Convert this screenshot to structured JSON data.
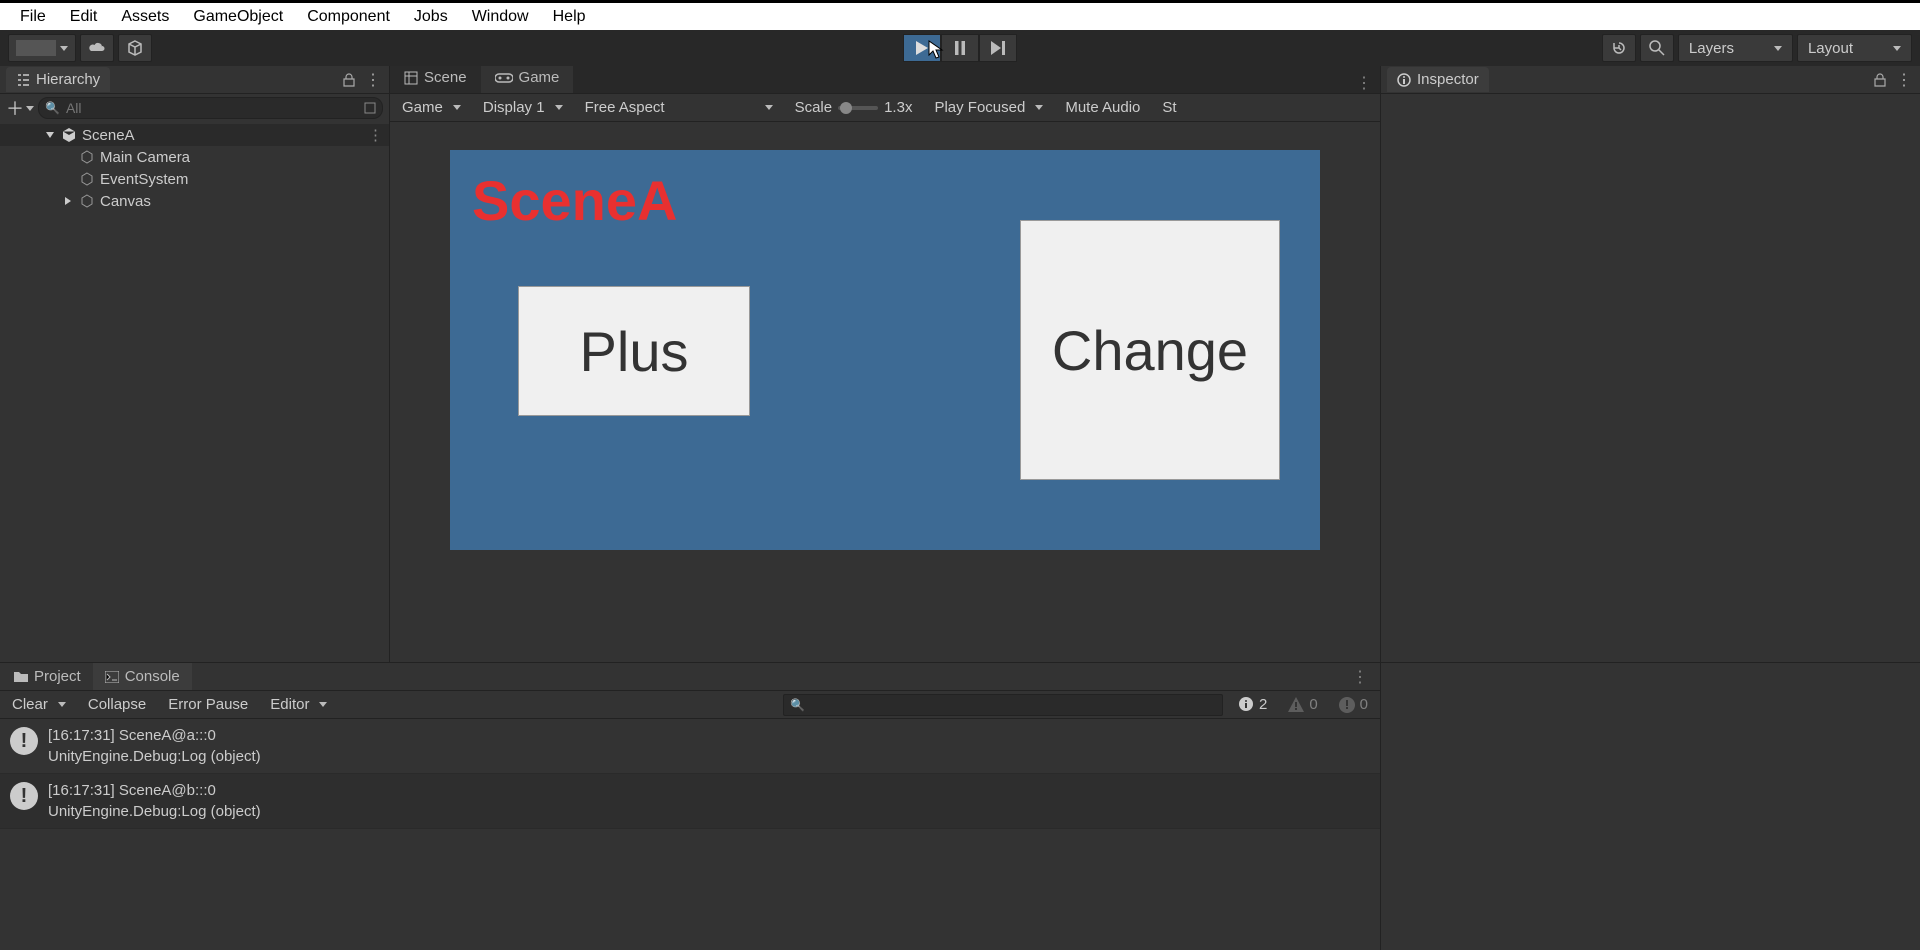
{
  "menubar": {
    "items": [
      "File",
      "Edit",
      "Assets",
      "GameObject",
      "Component",
      "Jobs",
      "Window",
      "Help"
    ]
  },
  "toolbar": {
    "layers_label": "Layers",
    "layout_label": "Layout"
  },
  "hierarchy": {
    "title": "Hierarchy",
    "search_placeholder": "All",
    "scene_name": "SceneA",
    "items": [
      {
        "label": "Main Camera"
      },
      {
        "label": "EventSystem"
      },
      {
        "label": "Canvas"
      }
    ]
  },
  "center": {
    "scene_tab": "Scene",
    "game_tab": "Game",
    "game_toolbar": {
      "game_dropdown": "Game",
      "display": "Display 1",
      "aspect": "Free Aspect",
      "scale_label": "Scale",
      "scale_value": "1.3x",
      "play_mode": "Play Focused",
      "mute": "Mute Audio",
      "stats_partial": "St"
    },
    "scene": {
      "title": "SceneA",
      "plus_btn": "Plus",
      "change_btn": "Change"
    }
  },
  "inspector": {
    "title": "Inspector"
  },
  "bottom": {
    "project_tab": "Project",
    "console_tab": "Console",
    "toolbar": {
      "clear": "Clear",
      "collapse": "Collapse",
      "error_pause": "Error Pause",
      "editor": "Editor"
    },
    "counters": {
      "info": "2",
      "warn": "0",
      "error": "0"
    },
    "logs": [
      {
        "line1": "[16:17:31] SceneA@a:::0",
        "line2": "UnityEngine.Debug:Log (object)"
      },
      {
        "line1": "[16:17:31] SceneA@b:::0",
        "line2": "UnityEngine.Debug:Log (object)"
      }
    ]
  }
}
